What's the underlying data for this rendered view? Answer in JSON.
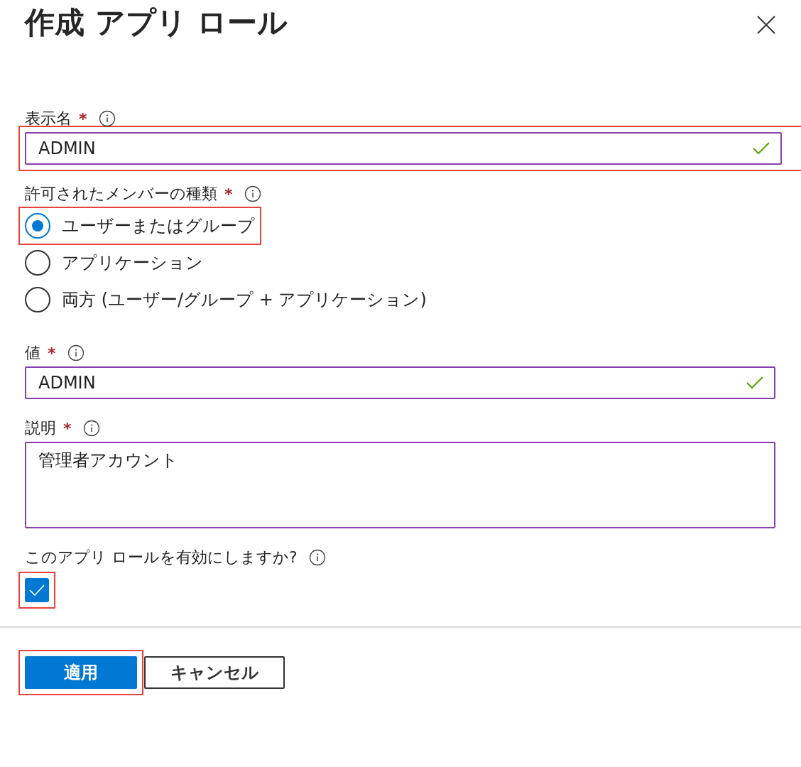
{
  "title": "作成 アプリ ロール",
  "fields": [
    {
      "kind": "text",
      "label": "表示名",
      "required_mark": "*",
      "value": "ADMIN",
      "valid": true,
      "highlighted": true
    },
    {
      "kind": "radio",
      "label": "許可されたメンバーの種類",
      "required_mark": "*",
      "options": [
        {
          "label": "ユーザーまたはグループ",
          "selected": true,
          "highlighted": true
        },
        {
          "label": "アプリケーション",
          "selected": false,
          "highlighted": false
        },
        {
          "label": "両方 (ユーザー/グループ + アプリケーション)",
          "selected": false,
          "highlighted": false
        }
      ]
    },
    {
      "kind": "text",
      "label": "値",
      "required_mark": "*",
      "value": "ADMIN",
      "valid": true,
      "highlighted": false
    },
    {
      "kind": "textarea",
      "label": "説明",
      "required_mark": "*",
      "value": "管理者アカウント",
      "highlighted": false
    },
    {
      "kind": "checkbox",
      "label": "このアプリ ロールを有効にしますか?",
      "checked": true,
      "highlighted": true
    }
  ],
  "buttons": [
    {
      "label": "適用",
      "kind": "primary",
      "highlighted": true
    },
    {
      "label": "キャンセル",
      "kind": "secondary",
      "highlighted": false
    }
  ]
}
